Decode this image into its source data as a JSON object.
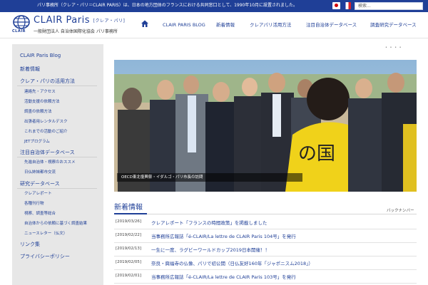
{
  "topbar": {
    "notice": "パリ事務所（クレア・パリ＝CLAIR PARIS）は、日本の地方団体のフランスにおける共同窓口として、1990年10月に設置されました。",
    "search_placeholder": "検索...",
    "bg_color": "#1f3f97"
  },
  "header": {
    "logo_sub": "CLAIR",
    "title": "CLAIR Paris",
    "title_tag": "[クレア・パリ]",
    "caption": "一般財団法人 自治体国際化協会 パリ事務所",
    "home_icon": "home-icon"
  },
  "nav": {
    "items": [
      {
        "label": "CLAIR PARIS BLOG"
      },
      {
        "label": "新着情報"
      },
      {
        "label": "クレアパリ活用方法"
      },
      {
        "label": "注目自治体データベース"
      },
      {
        "label": "調査研究データベース"
      }
    ]
  },
  "sidebar": {
    "blog": "CLAIR Paris Blog",
    "news": "新着情報",
    "usage": "クレア・パリの活用方法",
    "usage_items": [
      "連絡先・アクセス",
      "活動支援の依頼方法",
      "調査の依頼方法",
      "出張者用レンタルデスク",
      "これまでの活動のご紹介",
      "JETプログラム"
    ],
    "featured": "注目自治体データベース",
    "featured_items": [
      "先進自治体・視察のおススメ",
      "日仏姉妹都市交流"
    ],
    "research": "研究データベース",
    "research_items": [
      "クレアレポート",
      "各種刊行物",
      "視察、調査等総合",
      "自治体からの依頼に基づく調査結果",
      "ニュースレター（仏文）"
    ],
    "links": "リンク集",
    "privacy": "プライバシーポリシー"
  },
  "main": {
    "breadcrumb": "• • • •",
    "hero_caption": "OECD東北復興祭・イダルゴ・パリ市長の訪問",
    "news_title": "新着情報",
    "back_number": "バックナンバー",
    "news": [
      {
        "date": "[2019/03/26]",
        "text": "クレアレポート「フランスの時間政策」を掲載しました"
      },
      {
        "date": "[2019/02/22]",
        "text": "当事務所広報誌「é-CLAIR/La lettre de CLAIR Paris 104号」を発行"
      },
      {
        "date": "[2019/02/13]",
        "text": "一生に一度、ラグビーワールドカップ2019日本開催！！"
      },
      {
        "date": "[2019/02/05]",
        "text": "奈良・興福寺の仏像、パリで初公開（日仏友好160年「ジャポニスム2018」）"
      },
      {
        "date": "[2019/02/01]",
        "text": "当事務所広報誌「é-CLAIR/La lettre de CLAIR Paris 103号」を発行"
      }
    ]
  }
}
